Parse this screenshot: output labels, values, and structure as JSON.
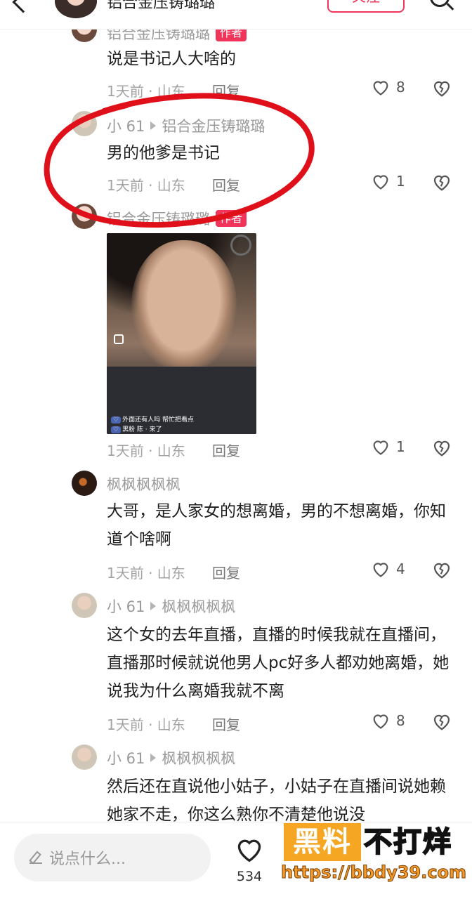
{
  "header": {
    "author_name": "铝合金压铸璐璐",
    "follow_label": "关注"
  },
  "comments": [
    {
      "user": "铝合金压铸璐璐",
      "badge": "作者",
      "text": "说是书记人大啥的",
      "time": "1天前 · 山东",
      "reply_label": "回复",
      "likes": "8"
    },
    {
      "user": "小 61",
      "reply_to": "铝合金压铸璐璐",
      "text": "男的他爹是书记",
      "time": "1天前 · 山东",
      "reply_label": "回复",
      "likes": "1"
    },
    {
      "user": "铝合金压铸璐璐",
      "badge": "作者",
      "image_overlay": {
        "line1": "外面还有人吗 帮忙把看点",
        "line2": "黑粉 陈 · 来了"
      },
      "time": "1天前 · 山东",
      "reply_label": "回复",
      "likes": "1"
    },
    {
      "user": "枫枫枫枫枫",
      "text": "大哥，是人家女的想离婚，男的不想离婚，你知道个啥啊",
      "time": "1天前 · 山东",
      "reply_label": "回复",
      "likes": "4"
    },
    {
      "user": "小 61",
      "reply_to": "枫枫枫枫枫",
      "text": "这个女的去年直播，直播的时候我就在直播间，直播那时候就说他男人pc好多人都劝她离婚，她说我为什么离婚我就不离",
      "time": "1天前 · 山东",
      "reply_label": "回复",
      "likes": "8"
    },
    {
      "user": "小 61",
      "reply_to": "枫枫枫枫枫",
      "text": "然后还在直说他小姑子，小姑子在直播间说她赖她家不走，你这么熟你不清楚他说没"
    }
  ],
  "bottom_bar": {
    "input_placeholder": "说点什么...",
    "like_count": "534"
  },
  "watermark": {
    "brand_left": "黑料",
    "brand_right": "不打烊",
    "url": "https://bbdy39.com"
  },
  "colors": {
    "accent": "#f0345a",
    "annotation": "#e0101a",
    "watermark_orange": "#f5a623"
  }
}
